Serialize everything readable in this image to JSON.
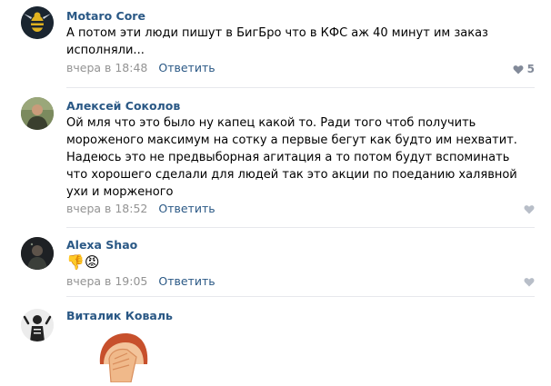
{
  "comments": [
    {
      "author": "Motaro Core",
      "text": "А потом эти люди пишут в БигБро что в КФС аж 40 минут им заказ исполняли...",
      "time": "вчера в 18:48",
      "reply": "Ответить",
      "likes": "5",
      "avatar_icon": "wasp-logo-icon"
    },
    {
      "author": "Алексей Соколов",
      "text": "Ой мля что это было ну капец какой то. Ради того чтоб получить мороженого максимум на сотку а первые бегут как будто им нехватит. Надеюсь это не предвыборная агитация а то потом будут вспоминать что хорошего сделали для людей так это акции по поеданию халявной ухи и морженого",
      "time": "вчера в 18:52",
      "reply": "Ответить",
      "avatar_icon": "person-photo-icon"
    },
    {
      "author": "Alexa Shao",
      "text": "👎😡",
      "time": "вчера в 19:05",
      "reply": "Ответить",
      "avatar_icon": "person-dark-photo-icon"
    },
    {
      "author": "Виталик Коваль",
      "avatar_icon": "skeleton-avatar-icon",
      "sticker": "facepalm-sticker"
    }
  ],
  "colors": {
    "link": "#2a5885",
    "meta": "#939393",
    "divider": "#e7e8ec"
  }
}
